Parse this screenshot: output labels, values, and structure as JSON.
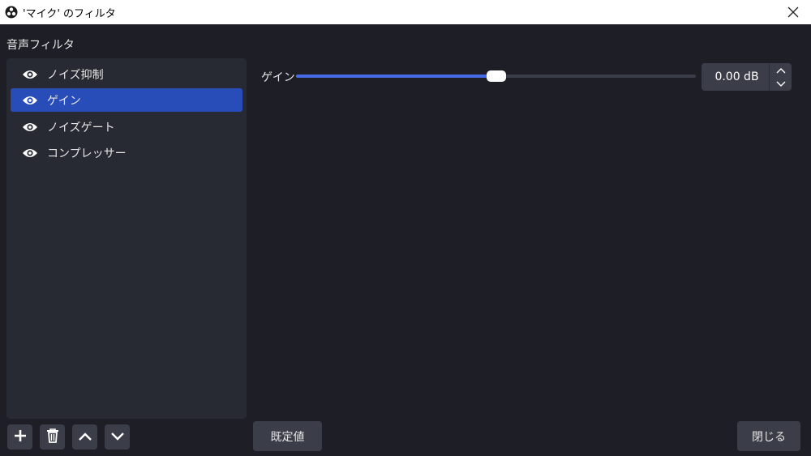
{
  "window": {
    "title": "'マイク' のフィルタ",
    "logo_icon": "obs-logo-icon",
    "close_icon": "close-icon"
  },
  "section_label": "音声フィルタ",
  "filters": [
    {
      "label": "ノイズ抑制",
      "icon": "eye-icon",
      "selected": false
    },
    {
      "label": "ゲイン",
      "icon": "eye-icon",
      "selected": true
    },
    {
      "label": "ノイズゲート",
      "icon": "eye-icon",
      "selected": false
    },
    {
      "label": "コンプレッサー",
      "icon": "eye-icon",
      "selected": false
    }
  ],
  "gain": {
    "label": "ゲイン",
    "value_text": "0.00 dB",
    "slider_fraction": 0.5
  },
  "toolbar": {
    "add_icon": "plus-icon",
    "remove_icon": "trash-icon",
    "up_icon": "chevron-up-icon",
    "down_icon": "chevron-down-icon"
  },
  "buttons": {
    "defaults": "既定値",
    "close": "閉じる"
  },
  "colors": {
    "background": "#1e1f26",
    "panel": "#272a33",
    "selection": "#284cb8",
    "slider_accent": "#476be6",
    "button": "#3b3e48"
  }
}
